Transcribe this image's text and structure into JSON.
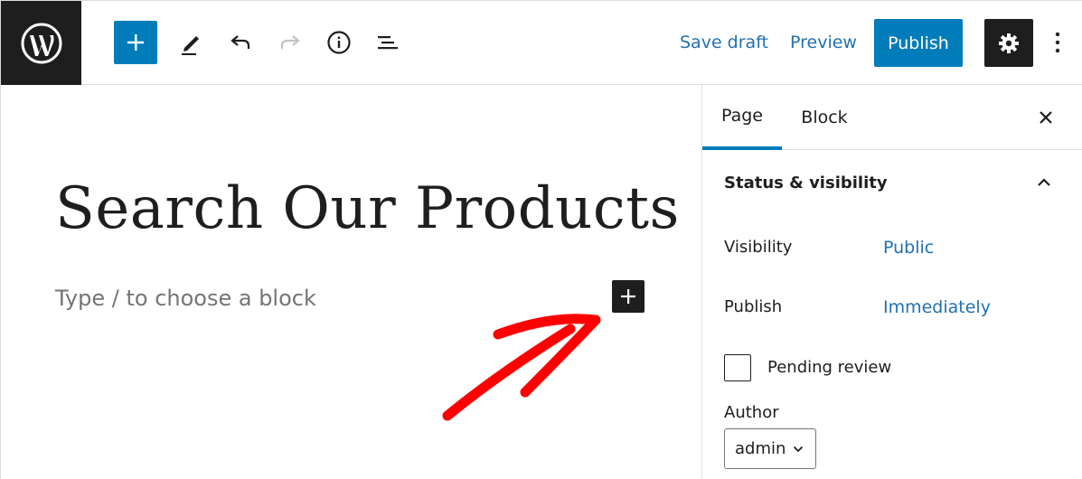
{
  "toolbar": {
    "save_draft_label": "Save draft",
    "preview_label": "Preview",
    "publish_label": "Publish",
    "icons": [
      "wordpress-logo-icon",
      "plus-icon",
      "pencil-icon",
      "undo-icon",
      "redo-icon",
      "info-icon",
      "list-view-icon",
      "gear-icon",
      "more-vertical-icon"
    ]
  },
  "editor": {
    "title": "Search Our Products",
    "block_placeholder": "Type / to choose a block"
  },
  "sidebar": {
    "tabs": [
      {
        "label": "Page",
        "active": true
      },
      {
        "label": "Block",
        "active": false
      }
    ],
    "panel": {
      "title": "Status & visibility",
      "visibility_label": "Visibility",
      "visibility_value": "Public",
      "publish_label": "Publish",
      "publish_value": "Immediately",
      "pending_review_label": "Pending review",
      "author_label": "Author",
      "author_value": "admin"
    }
  },
  "colors": {
    "accent": "#007cba",
    "link": "#2271b1",
    "dark": "#1e1e1e",
    "annotation_arrow": "#ff0000"
  }
}
